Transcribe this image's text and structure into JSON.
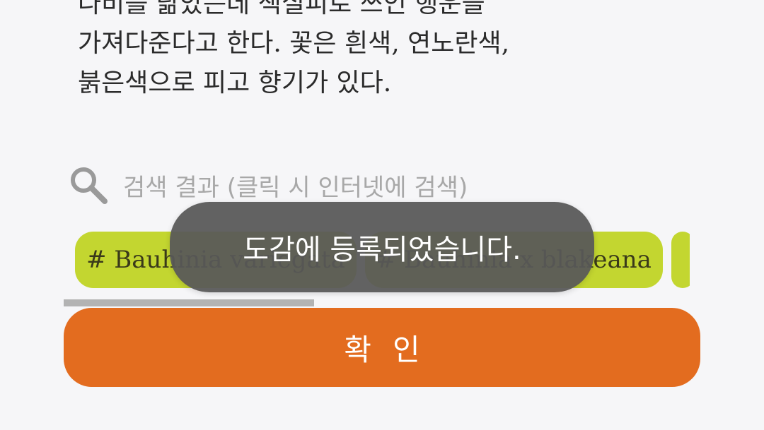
{
  "description": {
    "lines": [
      "나비를 닮았는데 색실피로 쓰인 행운을",
      "가져다준다고 한다. 꽃은 흰색, 연노란색,",
      "붉은색으로 피고 향기가 있다."
    ]
  },
  "search": {
    "label": "검색 결과 (클릭 시 인터넷에 검색)"
  },
  "tags": [
    "# Bauhinia variegata",
    "# Bauhinia x blakeana",
    ""
  ],
  "confirm_label": "확인",
  "toast_message": "도감에 등록되었습니다.",
  "colors": {
    "tag": "#c3d630",
    "confirm": "#e36c1f",
    "toast": "#585858"
  },
  "scroll_position": 0.4
}
